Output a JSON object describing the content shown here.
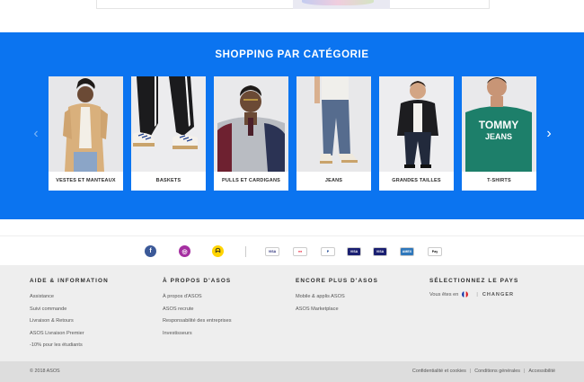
{
  "category_section": {
    "title": "SHOPPING PAR CATÉGORIE",
    "prev_arrow": "‹",
    "next_arrow": "›",
    "cards": [
      {
        "label": "VESTES ET MANTEAUX"
      },
      {
        "label": "BASKETS"
      },
      {
        "label": "PULLS ET CARDIGANS"
      },
      {
        "label": "JEANS"
      },
      {
        "label": "GRANDES TAILLES"
      },
      {
        "label": "T-SHIRTS"
      }
    ],
    "tshirt_print": {
      "line1": "TOMMY",
      "line2": "JEANS"
    },
    "band_color": "#0b74f0"
  },
  "social": [
    {
      "name": "facebook-icon",
      "glyph": "f",
      "color": "#3b5998"
    },
    {
      "name": "instagram-icon",
      "glyph": "◎",
      "color": "#a52fa1"
    },
    {
      "name": "snapchat-icon",
      "glyph": "ᗣ",
      "color": "#ffd400"
    }
  ],
  "payments": [
    {
      "name": "visa-icon",
      "text": "VISA"
    },
    {
      "name": "mastercard-icon",
      "text": "●●"
    },
    {
      "name": "paypal-icon",
      "text": "P"
    },
    {
      "name": "visa-electron-icon",
      "text": "VISA"
    },
    {
      "name": "visa-blue-icon",
      "text": "VISA"
    },
    {
      "name": "amex-icon",
      "text": "AMEX"
    },
    {
      "name": "apple-pay-icon",
      "text": "Pay"
    }
  ],
  "footer": {
    "col1": {
      "heading": "AIDE & INFORMATION",
      "links": [
        "Assistance",
        "Suivi commande",
        "Livraison & Retours",
        "ASOS Livraison Premier",
        "-10% pour les étudiants"
      ]
    },
    "col2": {
      "heading": "À PROPOS D'ASOS",
      "links": [
        "À propos d'ASOS",
        "ASOS recrute",
        "Responsabilité des entreprises",
        "Investisseurs"
      ]
    },
    "col3": {
      "heading": "ENCORE PLUS D'ASOS",
      "links": [
        "Mobile & applis ASOS",
        "ASOS Marketplace"
      ]
    },
    "col4": {
      "heading": "SÉLECTIONNEZ LE PAYS",
      "country_text": "Vous êtes en",
      "separator": "|",
      "change_label": "CHANGER"
    }
  },
  "bottom": {
    "copyright": "© 2018 ASOS",
    "links": [
      "Confidentialité et cookies",
      "Conditions générales",
      "Accessibilité"
    ],
    "separator": "|"
  }
}
